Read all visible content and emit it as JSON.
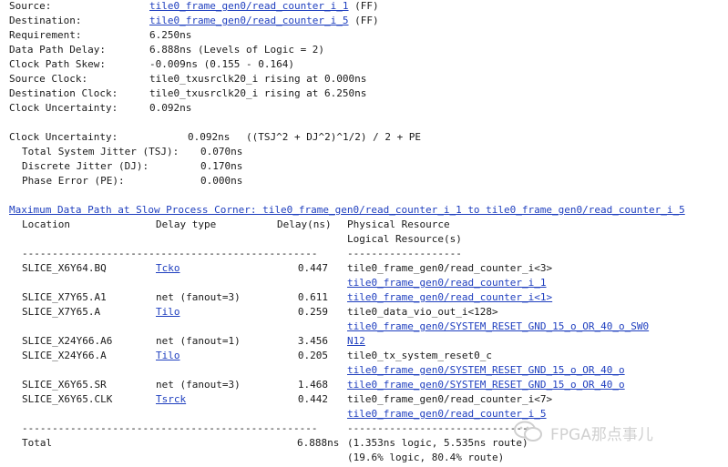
{
  "summary": [
    {
      "label": "Source:",
      "value": "tile0_frame_gen0/read_counter_i_1",
      "suffix": " (FF)",
      "link": true
    },
    {
      "label": "Destination:",
      "value": "tile0_frame_gen0/read_counter_i_5",
      "suffix": " (FF)",
      "link": true
    },
    {
      "label": "Requirement:",
      "value": "6.250ns",
      "suffix": "",
      "link": false
    },
    {
      "label": "Data Path Delay:",
      "value": "6.888ns (Levels of Logic = 2)",
      "suffix": "",
      "link": false
    },
    {
      "label": "Clock Path Skew:",
      "value": "-0.009ns (0.155 - 0.164)",
      "suffix": "",
      "link": false
    },
    {
      "label": "Source Clock:",
      "value": "tile0_txusrclk20_i rising at 0.000ns",
      "suffix": "",
      "link": false
    },
    {
      "label": "Destination Clock:",
      "value": "tile0_txusrclk20_i rising at 6.250ns",
      "suffix": "",
      "link": false
    },
    {
      "label": "Clock Uncertainty:",
      "value": "0.092ns",
      "suffix": "",
      "link": false
    }
  ],
  "uncertainty": {
    "label": "Clock Uncertainty:",
    "value": "0.092ns",
    "formula": "((TSJ^2 + DJ^2)^1/2) / 2 + PE",
    "items": [
      {
        "label": "Total System Jitter (TSJ):",
        "value": "0.070ns"
      },
      {
        "label": "Discrete Jitter (DJ):",
        "value": "0.170ns"
      },
      {
        "label": "Phase Error (PE):",
        "value": "0.000ns"
      }
    ]
  },
  "path": {
    "title": "Maximum Data Path at Slow Process Corner: tile0_frame_gen0/read_counter_i_1 to tile0_frame_gen0/read_counter_i_5",
    "headers": {
      "location": "Location",
      "delay_type": "Delay type",
      "delay": "Delay(ns)",
      "phys": "Physical Resource",
      "logical": "Logical Resource(s)"
    },
    "rule_left": "-------------------------------------------------",
    "rule_right": "-------------------",
    "rule_right_end": "-------------------------------",
    "rows": [
      {
        "location": "SLICE_X6Y64.BQ",
        "delay_type": "Tcko",
        "type_link": true,
        "delay": "0.447",
        "resources": [
          {
            "text": "tile0_frame_gen0/read_counter_i<3>",
            "link": false
          },
          {
            "text": "tile0_frame_gen0/read_counter_i_1",
            "link": true
          }
        ]
      },
      {
        "location": "SLICE_X7Y65.A1",
        "delay_type": "net (fanout=3)",
        "type_link": false,
        "delay": "0.611",
        "resources": [
          {
            "text": "tile0_frame_gen0/read_counter_i<1>",
            "link": true
          }
        ]
      },
      {
        "location": "SLICE_X7Y65.A",
        "delay_type": "Tilo",
        "type_link": true,
        "delay": "0.259",
        "resources": [
          {
            "text": "tile0_data_vio_out_i<128>",
            "link": false
          },
          {
            "text": "tile0_frame_gen0/SYSTEM_RESET_GND_15_o_OR_40_o_SW0",
            "link": true
          }
        ]
      },
      {
        "location": "SLICE_X24Y66.A6",
        "delay_type": "net (fanout=1)",
        "type_link": false,
        "delay": "3.456",
        "resources": [
          {
            "text": "N12",
            "link": true
          }
        ]
      },
      {
        "location": "SLICE_X24Y66.A",
        "delay_type": "Tilo",
        "type_link": true,
        "delay": "0.205",
        "resources": [
          {
            "text": "tile0_tx_system_reset0_c",
            "link": false
          },
          {
            "text": "tile0_frame_gen0/SYSTEM_RESET_GND_15_o_OR_40_o",
            "link": true
          }
        ]
      },
      {
        "location": "SLICE_X6Y65.SR",
        "delay_type": "net (fanout=3)",
        "type_link": false,
        "delay": "1.468",
        "resources": [
          {
            "text": "tile0_frame_gen0/SYSTEM_RESET_GND_15_o_OR_40_o",
            "link": true
          }
        ]
      },
      {
        "location": "SLICE_X6Y65.CLK",
        "delay_type": "Tsrck",
        "type_link": true,
        "delay": "0.442",
        "resources": [
          {
            "text": "tile0_frame_gen0/read_counter_i<7>",
            "link": false
          },
          {
            "text": "tile0_frame_gen0/read_counter_i_5",
            "link": true
          }
        ]
      }
    ],
    "total": {
      "label": "Total",
      "delay": "6.888ns",
      "line1": "(1.353ns logic, 5.535ns route)",
      "line2": "(19.6% logic, 80.4% route)"
    }
  },
  "watermark": {
    "text": "FPGA那点事儿",
    "icon": "wechat-icon"
  }
}
